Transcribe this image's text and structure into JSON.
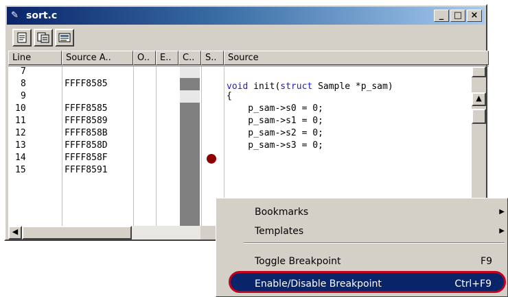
{
  "window": {
    "title": "sort.c",
    "icon": "document-icon"
  },
  "toolbar": {
    "buttons": [
      "editor-view-icon",
      "mixed-view-icon",
      "disassembly-view-icon"
    ]
  },
  "columns": [
    "Line",
    "Source A..",
    "O..",
    "E..",
    "C..",
    "S..",
    "Source"
  ],
  "rows": [
    {
      "line": "7",
      "address": "",
      "source": ""
    },
    {
      "line": "8",
      "address": "FFFF8585",
      "source_kw1": "void",
      "source_mid": " init(",
      "source_kw2": "struct",
      "source_rest": " Sample *p_sam)"
    },
    {
      "line": "9",
      "address": "",
      "source": "{"
    },
    {
      "line": "10",
      "address": "FFFF8585",
      "source": "    p_sam->s0 = 0;"
    },
    {
      "line": "11",
      "address": "FFFF8589",
      "source": "    p_sam->s1 = 0;"
    },
    {
      "line": "12",
      "address": "FFFF858B",
      "source": "    p_sam->s2 = 0;"
    },
    {
      "line": "13",
      "address": "FFFF858D",
      "source": "    p_sam->s3 = 0;",
      "breakpoint": true
    },
    {
      "line": "14",
      "address": "FFFF858F",
      "source": ""
    },
    {
      "line": "15",
      "address": "FFFF8591",
      "source": ""
    }
  ],
  "colors": {
    "breakpoint": "#8b0000",
    "keyword": "#1c1cc8",
    "highlight": "#0a246a",
    "outline": "#c4001a"
  },
  "context_menu": {
    "items": [
      {
        "label": "Bookmarks",
        "shortcut": "",
        "submenu": true
      },
      {
        "label": "Templates",
        "shortcut": "",
        "submenu": true
      },
      {
        "label": "Toggle Breakpoint",
        "shortcut": "F9",
        "submenu": false
      },
      {
        "label": "Enable/Disable Breakpoint",
        "shortcut": "Ctrl+F9",
        "submenu": false,
        "highlighted": true
      }
    ]
  }
}
